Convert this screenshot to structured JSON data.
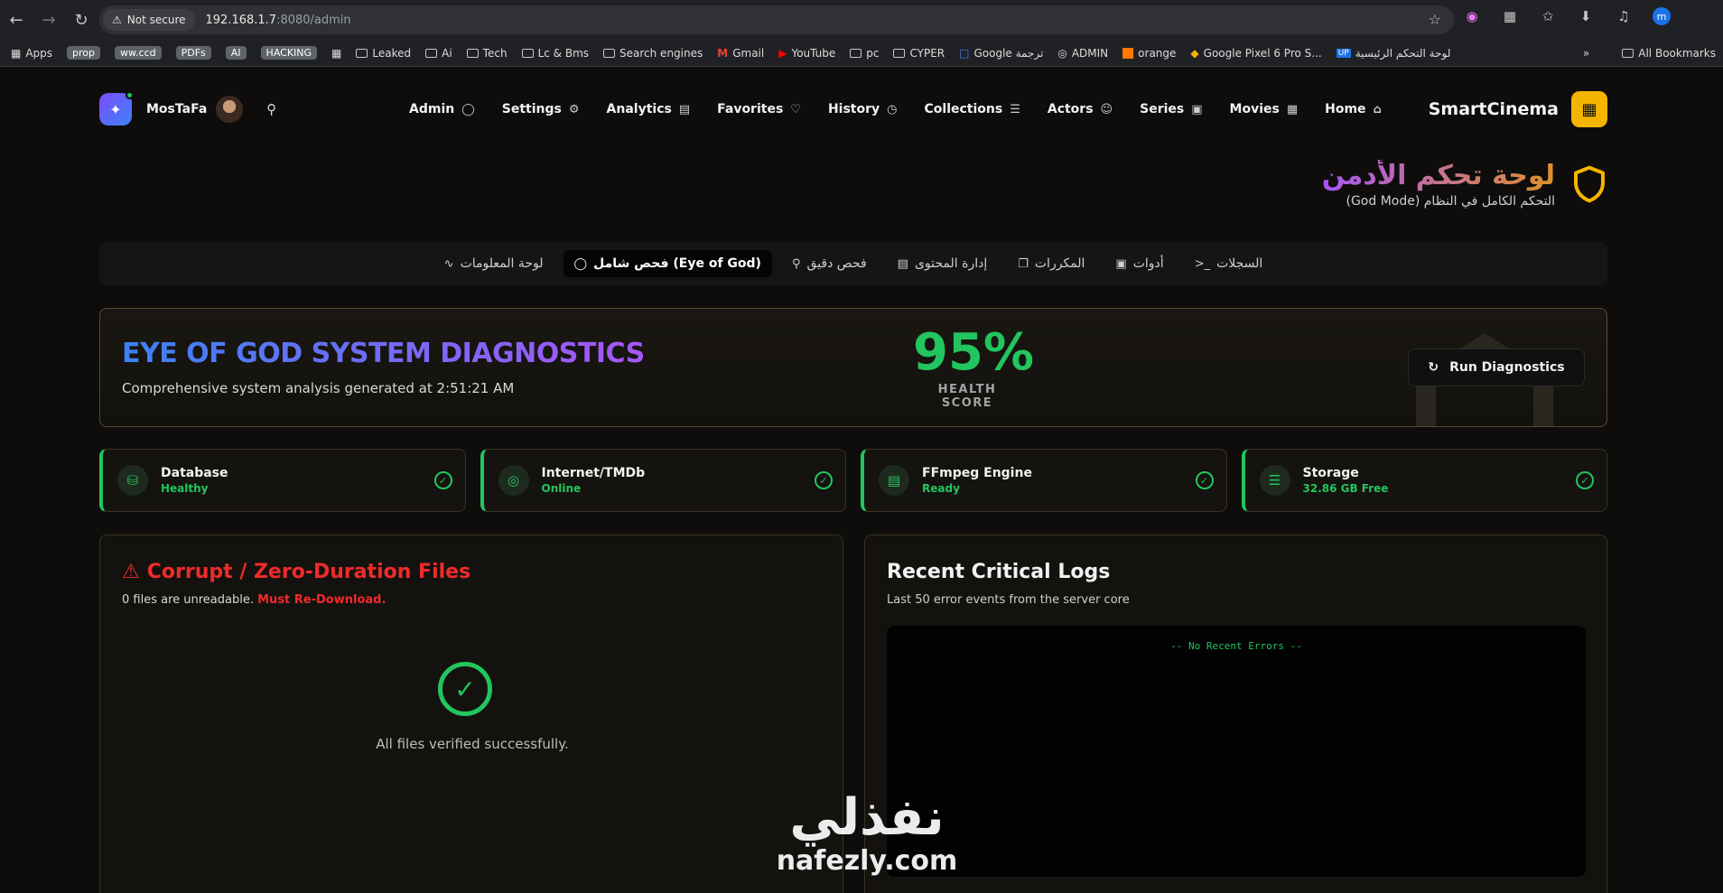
{
  "browser": {
    "security_label": "Not secure",
    "url_host": "192.168.1.7",
    "url_rest": ":8080/admin",
    "profile_initial": "m"
  },
  "bookmarks": {
    "apps": "Apps",
    "tags": [
      "prop",
      "ww.ccd",
      "PDFs",
      "AI",
      "HACKING"
    ],
    "items": [
      "Leaked",
      "Ai",
      "Tech",
      "Lc & Bms",
      "Search engines",
      "Gmail",
      "YouTube",
      "pc",
      "CYPER",
      "Google ترجمة",
      "ADMIN",
      "orange",
      "Google Pixel 6 Pro S...",
      "لوحة التحكم الرئيسية"
    ],
    "all": "All Bookmarks"
  },
  "nav": {
    "user": "MosTaFa",
    "brand": "SmartCinema",
    "items": [
      {
        "label": "Admin",
        "icon": "shield-icon"
      },
      {
        "label": "Settings",
        "icon": "gear-icon"
      },
      {
        "label": "Analytics",
        "icon": "bar-chart-icon"
      },
      {
        "label": "Favorites",
        "icon": "heart-icon"
      },
      {
        "label": "History",
        "icon": "clock-icon"
      },
      {
        "label": "Collections",
        "icon": "layers-icon"
      },
      {
        "label": "Actors",
        "icon": "users-icon"
      },
      {
        "label": "Series",
        "icon": "tv-icon"
      },
      {
        "label": "Movies",
        "icon": "film-icon"
      },
      {
        "label": "Home",
        "icon": "home-icon"
      }
    ]
  },
  "page": {
    "title": "لوحة تحكم الأدمن",
    "subtitle": "التحكم الكامل في النظام (God Mode)"
  },
  "tabs": [
    {
      "label": "لوحة المعلومات",
      "icon": "activity-icon"
    },
    {
      "label": "فحص شامل (Eye of God)",
      "icon": "shield-icon",
      "active": true
    },
    {
      "label": "فحص دقيق",
      "icon": "search-icon"
    },
    {
      "label": "إدارة المحتوى",
      "icon": "file-icon"
    },
    {
      "label": "المكررات",
      "icon": "copy-icon"
    },
    {
      "label": "أدوات",
      "icon": "toolbox-icon"
    },
    {
      "label": "السجلات",
      "icon": "terminal-icon"
    }
  ],
  "diagnostics": {
    "title": "EYE OF GOD SYSTEM DIAGNOSTICS",
    "subtitle": "Comprehensive system analysis generated at 2:51:21 AM",
    "health_score": "95%",
    "health_label": "HEALTH SCORE",
    "run_button": "Run Diagnostics"
  },
  "status_cards": [
    {
      "name": "Database",
      "state": "Healthy",
      "icon": "database-icon"
    },
    {
      "name": "Internet/TMDb",
      "state": "Online",
      "icon": "globe-icon"
    },
    {
      "name": "FFmpeg Engine",
      "state": "Ready",
      "icon": "clapper-icon"
    },
    {
      "name": "Storage",
      "state": "32.86 GB Free",
      "icon": "server-icon"
    }
  ],
  "corrupt_panel": {
    "title": "Corrupt / Zero-Duration Files",
    "subtitle": "0 files are unreadable.",
    "subtitle_emph": "Must Re-Download.",
    "ok_text": "All files verified successfully."
  },
  "logs_panel": {
    "title": "Recent Critical Logs",
    "subtitle": "Last 50 error events from the server core",
    "console_msg": "-- No Recent Errors --"
  },
  "watermark": {
    "arabic": "نفذلي",
    "latin": "nafezly.com"
  },
  "colors": {
    "accent_yellow": "#f5b400",
    "success_green": "#22c55e",
    "danger_red": "#ef2b2b"
  }
}
